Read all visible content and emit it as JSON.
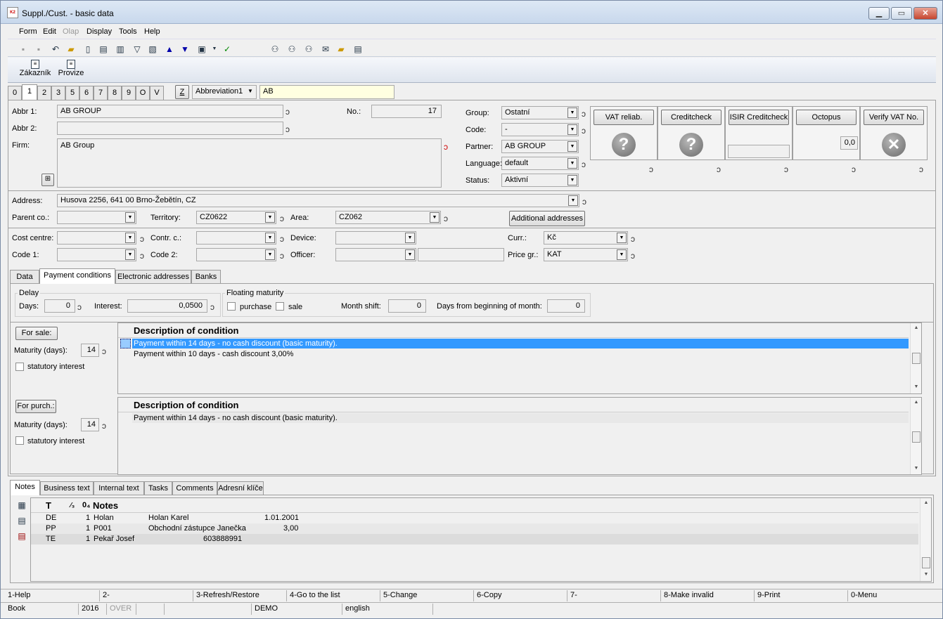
{
  "window": {
    "title": "Suppl./Cust. - basic data",
    "icon": "app-icon"
  },
  "menu": [
    "Form",
    "Edit",
    "Olap",
    "Display",
    "Tools",
    "Help"
  ],
  "toolbar2": {
    "customer": "Zákazník",
    "commission": "Provize"
  },
  "record_tabs": [
    "0",
    "1",
    "2",
    "3",
    "5",
    "6",
    "7",
    "8",
    "9",
    "O",
    "V"
  ],
  "search": {
    "z_label": "Z",
    "key_combo": "Abbreviation1",
    "value": "AB"
  },
  "form": {
    "abbr1_label": "Abbr 1:",
    "abbr1": "AB GROUP",
    "abbr2_label": "Abbr 2:",
    "abbr2": "",
    "firm_label": "Firm:",
    "firm": "AB Group",
    "no_label": "No.:",
    "no": "17",
    "group_label": "Group:",
    "group": "Ostatní",
    "code_label": "Code:",
    "code": "-",
    "partner_label": "Partner:",
    "partner": "AB GROUP",
    "language_label": "Language:",
    "language": "default",
    "status_label": "Status:",
    "status": "Aktivní",
    "address_label": "Address:",
    "address": "Husova 2256, 641 00  Brno-Žebětín, CZ",
    "parent_label": "Parent co.:",
    "parent": "",
    "territory_label": "Territory:",
    "territory": "CZ0622",
    "area_label": "Area:",
    "area": "CZ062",
    "additional_addresses": "Additional addresses",
    "cost_label": "Cost centre:",
    "contr_label": "Contr. c.:",
    "device_label": "Device:",
    "curr_label": "Curr.:",
    "curr": "Kč",
    "code1_label": "Code 1:",
    "code2_label": "Code 2:",
    "officer_label": "Officer:",
    "price_label": "Price gr.:",
    "price": "KAT"
  },
  "checks": {
    "vat": "VAT reliab.",
    "credit": "Creditcheck",
    "isir": "ISIR Creditcheck",
    "octopus": "Octopus",
    "octopus_val": "0,0",
    "verify": "Verify VAT No."
  },
  "subtabs": [
    "Data",
    "Payment conditions",
    "Electronic addresses",
    "Banks"
  ],
  "payment": {
    "delay_group": "Delay",
    "days_label": "Days:",
    "days": "0",
    "interest_label": "Interest:",
    "interest": "0,0500",
    "floating_group": "Floating maturity",
    "purchase": "purchase",
    "sale": "sale",
    "month_shift_label": "Month shift:",
    "month_shift": "0",
    "days_from_label": "Days from beginning of month:",
    "days_from": "0",
    "for_sale": "For sale:",
    "for_purch": "For purch.:",
    "maturity_label": "Maturity (days):",
    "sale_maturity": "14",
    "purch_maturity": "14",
    "statutory": "statutory interest",
    "grid_header": "Description of condition",
    "sale_rows": [
      "Payment within 14 days - no cash discount (basic maturity).",
      "Payment within 10 days - cash discount 3,00%"
    ],
    "purch_rows": [
      "Payment within 14 days - no cash discount (basic maturity)."
    ]
  },
  "bottom_tabs": [
    "Notes",
    "Business text",
    "Internal text",
    "Tasks",
    "Comments",
    "Adresní klíče"
  ],
  "notes": {
    "head_t": "T",
    "head_sub": "⁄₃",
    "head_att": "0₄",
    "head_notes": "Notes",
    "rows": [
      {
        "t": "DE",
        "n": "1",
        "a": "Holan",
        "b": "Holan Karel",
        "c": "1.01.2001"
      },
      {
        "t": "PP",
        "n": "1",
        "a": "P001",
        "b": "Obchodní zástupce Janečka",
        "c": "3,00"
      },
      {
        "t": "TE",
        "n": "1",
        "a": "Pekař Josef",
        "b": "",
        "c": "603888991"
      }
    ]
  },
  "fkeys": [
    "1-Help",
    "2-",
    "3-Refresh/Restore",
    "4-Go to the list",
    "5-Change",
    "6-Copy",
    "7-",
    "8-Make invalid",
    "9-Print",
    "0-Menu"
  ],
  "status": {
    "book": "Book",
    "year": "2016",
    "over": "OVER",
    "db": "DEMO",
    "lang": "english"
  }
}
